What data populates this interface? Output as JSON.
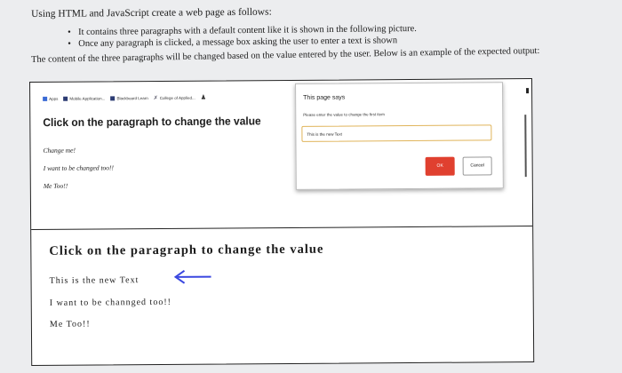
{
  "intro": "Using HTML and JavaScript create a web page as follows:",
  "bullets": [
    "It contains three paragraphs with a default content like it is shown in the following picture.",
    "Once any paragraph is clicked, a message box asking the user to enter a text is shown"
  ],
  "outro": "The content of the three paragraphs will be changed based on the value entered by the user. Below is an example of the expected output:",
  "browser": {
    "bookmarks": [
      "Apps",
      "Mobile Application...",
      "Blackboard Learn",
      "College of Applied..."
    ],
    "heading": "Click on the paragraph to change the value",
    "paragraphs": [
      "Change me!",
      "I want to be changed too!!",
      "Me Too!!"
    ]
  },
  "dialog": {
    "title": "This page says",
    "message": "Please enter the value to change the first item",
    "input_value": "This is the new Text",
    "ok_label": "OK",
    "cancel_label": "Cancel"
  },
  "result": {
    "heading": "Click on the paragraph to change the value",
    "paragraphs": [
      "This is the new Text",
      "I want to be channged too!!",
      "Me Too!!"
    ]
  }
}
